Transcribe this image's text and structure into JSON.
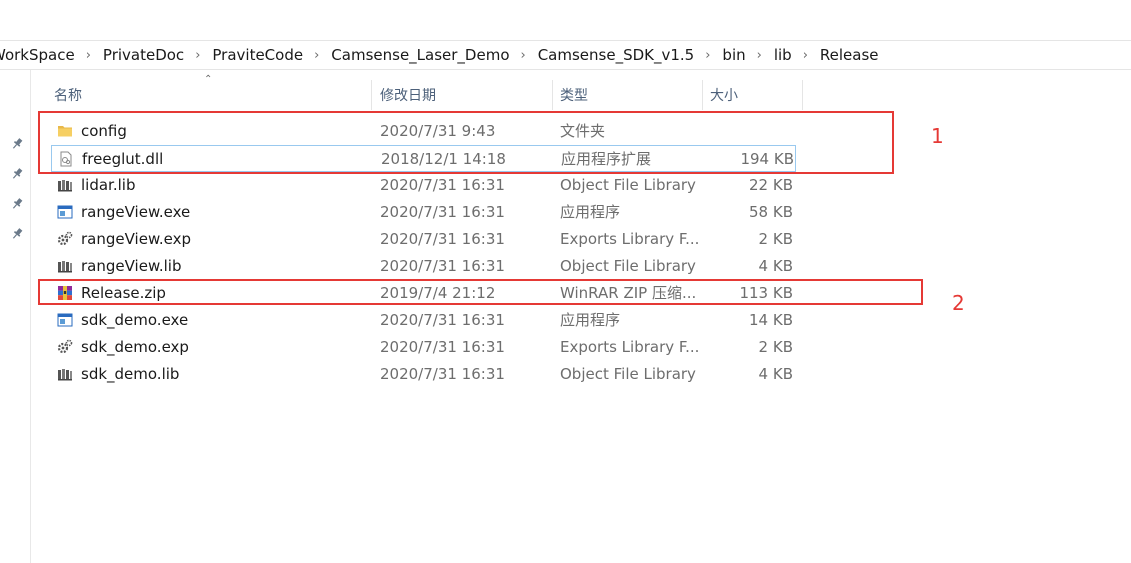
{
  "breadcrumb": [
    "WorkSpace",
    "PrivateDoc",
    "PraviteCode",
    "Camsense_Laser_Demo",
    "Camsense_SDK_v1.5",
    "bin",
    "lib",
    "Release"
  ],
  "breadcrumb_sep": "›",
  "columns": {
    "name": "名称",
    "date": "修改日期",
    "type": "类型",
    "size": "大小"
  },
  "files": [
    {
      "name": "config",
      "date": "2020/7/31 9:43",
      "type": "文件夹",
      "size": "",
      "icon": "folder-icon"
    },
    {
      "name": "freeglut.dll",
      "date": "2018/12/1 14:18",
      "type": "应用程序扩展",
      "size": "194 KB",
      "icon": "dll-icon"
    },
    {
      "name": "lidar.lib",
      "date": "2020/7/31 16:31",
      "type": "Object File Library",
      "size": "22 KB",
      "icon": "lib-icon"
    },
    {
      "name": "rangeView.exe",
      "date": "2020/7/31 16:31",
      "type": "应用程序",
      "size": "58 KB",
      "icon": "exe-icon"
    },
    {
      "name": "rangeView.exp",
      "date": "2020/7/31 16:31",
      "type": "Exports Library F...",
      "size": "2 KB",
      "icon": "exp-icon"
    },
    {
      "name": "rangeView.lib",
      "date": "2020/7/31 16:31",
      "type": "Object File Library",
      "size": "4 KB",
      "icon": "lib-icon"
    },
    {
      "name": "Release.zip",
      "date": "2019/7/4 21:12",
      "type": "WinRAR ZIP 压缩...",
      "size": "113 KB",
      "icon": "winrar-zip-icon"
    },
    {
      "name": "sdk_demo.exe",
      "date": "2020/7/31 16:31",
      "type": "应用程序",
      "size": "14 KB",
      "icon": "exe-icon"
    },
    {
      "name": "sdk_demo.exp",
      "date": "2020/7/31 16:31",
      "type": "Exports Library F...",
      "size": "2 KB",
      "icon": "exp-icon"
    },
    {
      "name": "sdk_demo.lib",
      "date": "2020/7/31 16:31",
      "type": "Object File Library",
      "size": "4 KB",
      "icon": "lib-icon"
    }
  ],
  "annotations": [
    {
      "label": "1",
      "color": "#e53935"
    },
    {
      "label": "2",
      "color": "#e53935"
    }
  ],
  "pins": [
    "pin-icon",
    "pin-icon",
    "pin-icon",
    "pin-icon"
  ]
}
